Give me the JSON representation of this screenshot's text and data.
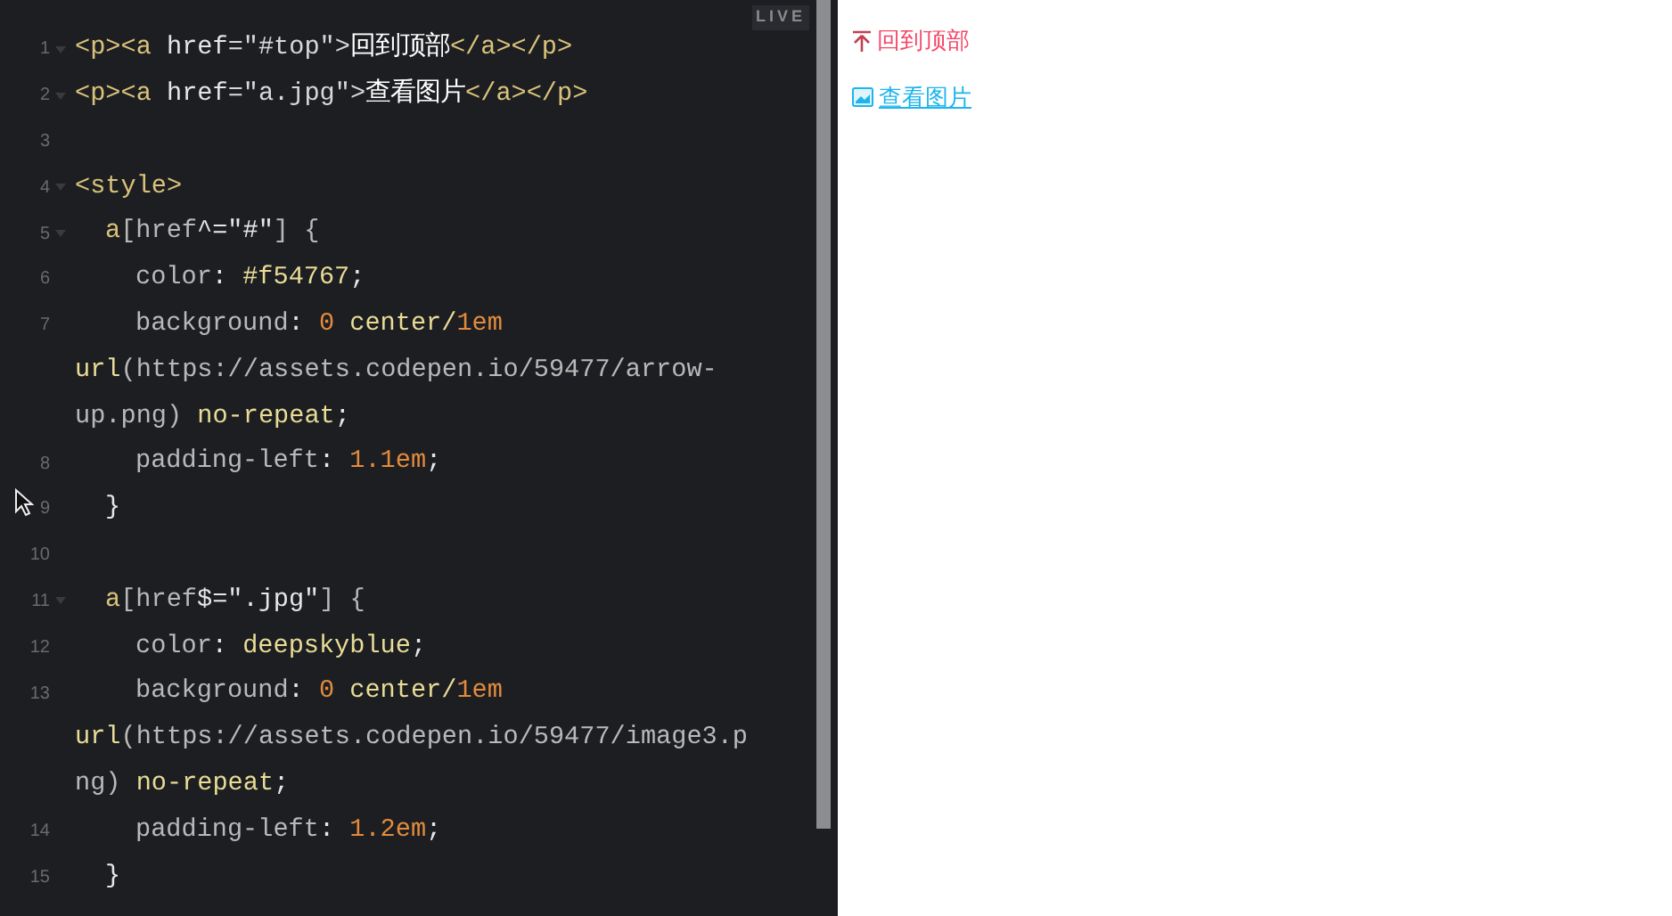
{
  "editor": {
    "badge": "LIVE",
    "lines": [
      {
        "number": "1",
        "kind": "top",
        "foldable": true,
        "tokens": [
          {
            "kind": "tag",
            "text": "<p><a "
          },
          {
            "kind": "attr",
            "text": "href"
          },
          {
            "kind": "punct",
            "text": "=\"#top\">"
          },
          {
            "kind": "text",
            "text": "回到顶部"
          },
          {
            "kind": "tag",
            "text": "</a></p>"
          }
        ]
      },
      {
        "number": "2",
        "kind": "top",
        "foldable": true,
        "tokens": [
          {
            "kind": "tag",
            "text": "<p><a "
          },
          {
            "kind": "attr",
            "text": "href"
          },
          {
            "kind": "punct",
            "text": "=\"a.jpg\">"
          },
          {
            "kind": "text",
            "text": "查看图片"
          },
          {
            "kind": "tag",
            "text": "</a></p>"
          }
        ]
      },
      {
        "number": "3",
        "foldable": false
      },
      {
        "number": "4",
        "kind": "top",
        "foldable": true,
        "tokens": [
          {
            "kind": "tag",
            "text": "<style>"
          }
        ]
      },
      {
        "number": "5",
        "kind": "rule",
        "foldable": true,
        "tokens": [
          {
            "kind": "tag",
            "text": "a"
          },
          {
            "kind": "prop",
            "text": "[href"
          },
          {
            "kind": "attr",
            "text": "^=\"#\""
          },
          {
            "kind": "prop",
            "text": "] {"
          }
        ]
      },
      {
        "number": "6",
        "kind": "decl",
        "foldable": false,
        "tokens": [
          {
            "kind": "prop",
            "text": "color"
          },
          {
            "kind": "attr",
            "text": ": "
          },
          {
            "kind": "value",
            "text": "#f54767"
          },
          {
            "kind": "attr",
            "text": ";"
          }
        ]
      },
      {
        "number": "7",
        "kind": "decl",
        "foldable": false,
        "tokens": [
          {
            "kind": "prop",
            "text": "background"
          },
          {
            "kind": "attr",
            "text": ": "
          },
          {
            "kind": "number",
            "text": "0"
          },
          {
            "kind": "value",
            "text": " center/"
          },
          {
            "kind": "number",
            "text": "1em"
          }
        ]
      },
      {
        "kind": "wrap",
        "foldable": false,
        "tokens": [
          {
            "kind": "value",
            "text": "url"
          },
          {
            "kind": "prop",
            "text": "(https://assets.codepen.io/59477/arrow-"
          }
        ]
      },
      {
        "kind": "wrap",
        "foldable": false,
        "tokens": [
          {
            "kind": "prop",
            "text": "up.png) "
          },
          {
            "kind": "value",
            "text": "no-repeat"
          },
          {
            "kind": "attr",
            "text": ";"
          }
        ]
      },
      {
        "number": "8",
        "kind": "decl",
        "foldable": false,
        "tokens": [
          {
            "kind": "prop",
            "text": "padding-left"
          },
          {
            "kind": "attr",
            "text": ": "
          },
          {
            "kind": "number",
            "text": "1.1em"
          },
          {
            "kind": "attr",
            "text": ";"
          }
        ]
      },
      {
        "number": "9",
        "kind": "rule",
        "foldable": false,
        "tokens": [
          {
            "kind": "attr",
            "text": "}"
          }
        ]
      },
      {
        "number": "10",
        "foldable": false
      },
      {
        "number": "11",
        "kind": "rule",
        "foldable": true,
        "tokens": [
          {
            "kind": "tag",
            "text": "a"
          },
          {
            "kind": "prop",
            "text": "[href"
          },
          {
            "kind": "attr",
            "text": "$=\".jpg\""
          },
          {
            "kind": "prop",
            "text": "] {"
          }
        ]
      },
      {
        "number": "12",
        "kind": "decl",
        "foldable": false,
        "tokens": [
          {
            "kind": "prop",
            "text": "color"
          },
          {
            "kind": "attr",
            "text": ": "
          },
          {
            "kind": "value",
            "text": "deepskyblue"
          },
          {
            "kind": "attr",
            "text": ";"
          }
        ]
      },
      {
        "number": "13",
        "kind": "decl",
        "foldable": false,
        "tokens": [
          {
            "kind": "prop",
            "text": "background"
          },
          {
            "kind": "attr",
            "text": ": "
          },
          {
            "kind": "number",
            "text": "0"
          },
          {
            "kind": "value",
            "text": " center/"
          },
          {
            "kind": "number",
            "text": "1em"
          }
        ]
      },
      {
        "kind": "wrap",
        "foldable": false,
        "tokens": [
          {
            "kind": "value",
            "text": "url"
          },
          {
            "kind": "prop",
            "text": "(https://assets.codepen.io/59477/image3.p"
          }
        ]
      },
      {
        "kind": "wrap",
        "foldable": false,
        "tokens": [
          {
            "kind": "prop",
            "text": "ng) "
          },
          {
            "kind": "value",
            "text": "no-repeat"
          },
          {
            "kind": "attr",
            "text": ";"
          }
        ]
      },
      {
        "number": "14",
        "kind": "decl",
        "foldable": false,
        "tokens": [
          {
            "kind": "prop",
            "text": "padding-left"
          },
          {
            "kind": "attr",
            "text": ": "
          },
          {
            "kind": "number",
            "text": "1.2em"
          },
          {
            "kind": "attr",
            "text": ";"
          }
        ]
      },
      {
        "number": "15",
        "kind": "rule",
        "foldable": false,
        "tokens": [
          {
            "kind": "attr",
            "text": "}"
          }
        ]
      }
    ]
  },
  "preview": {
    "links": [
      {
        "kind": "arrow",
        "text": "回到顶部"
      },
      {
        "kind": "image",
        "text": "查看图片"
      }
    ]
  }
}
